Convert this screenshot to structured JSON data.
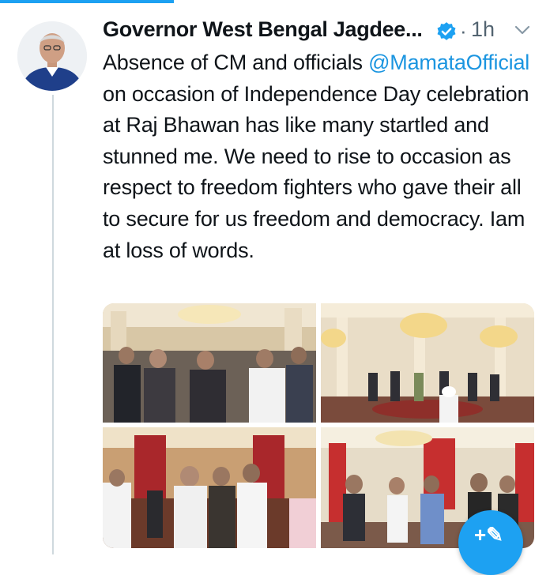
{
  "tweet": {
    "author_name": "Governor West Bengal Jagdee...",
    "separator": "·",
    "time": "1h",
    "text_before": "Absence of CM and officials ",
    "mention": "@MamataOfficial",
    "text_after": " on occasion of Independence Day celebration at Raj Bhawan has like many startled and stunned me. We need to rise to occasion as respect to freedom fighters who gave their all to secure for us freedom and democracy. Iam at loss of words.",
    "photos": [
      "photo-1",
      "photo-2",
      "photo-3",
      "photo-4"
    ]
  },
  "colors": {
    "accent": "#1da1f2",
    "mention": "#1b95e0",
    "secondary_text": "#536471"
  },
  "icons": {
    "verified": "verified-badge-icon",
    "more": "chevron-down-icon",
    "compose": "compose-icon"
  }
}
